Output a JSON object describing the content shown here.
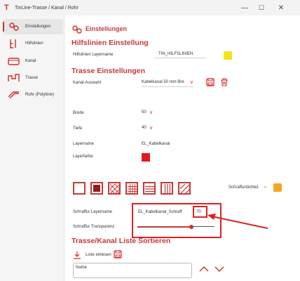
{
  "window": {
    "title": "TinLine-Trasse / Kanal / Rohr",
    "app_icon": "T",
    "min": "—",
    "max": "☐",
    "close": "✕"
  },
  "sidebar": {
    "items": [
      {
        "label": "Einstellungen",
        "icon": "settings-icon"
      },
      {
        "label": "Hilfslinien",
        "icon": "guideline-icon"
      },
      {
        "label": "Kanal",
        "icon": "channel-icon"
      },
      {
        "label": "Trasse",
        "icon": "route-icon"
      },
      {
        "label": "Rohr (Polylinie)",
        "icon": "pipe-icon"
      }
    ]
  },
  "page_title": "Einstellungen",
  "hilfslinien": {
    "title": "Hilfslinien Einstellung",
    "layer_label": "Hilfslinien Layername",
    "layer_value": "TIN_HILFSLINIEN",
    "layer_color": "#f4e21a"
  },
  "trasse": {
    "title": "Trasse Einstellungen",
    "kanal_label": "Kanal-Auswahl",
    "kanal_value": "Kabelkanal 50 mm Bre",
    "breite_label": "Breite",
    "breite_value": "50",
    "tiefe_label": "Tiefe",
    "tiefe_value": "40",
    "layername_label": "Layername",
    "layername_value": "EL_Kabelkanal",
    "layerfarbe_label": "Layerfarbe",
    "layer_color": "#e01b1b",
    "hatch_patterns": [
      "empty",
      "solid",
      "cross",
      "grid",
      "horizontal",
      "vertical",
      "diagonal"
    ],
    "dichte_label": "Schraffurdichte",
    "dichte_value": "1",
    "dichte_minus": "−",
    "dichte_color": "#f5a623",
    "schraffur_layer_label": "Schraffur Layername",
    "schraffur_layer_value": "EL_Kabelkanal_Schraff",
    "schraffur_number": "70",
    "transparenz_label": "Schraffur Transparenz",
    "transparenz_value": 0.7
  },
  "sortieren": {
    "title": "Trasse/Kanal Liste Sortieren",
    "einlesen_label": "Liste einlesen",
    "name_label": "Name"
  },
  "colors": {
    "accent": "#c43a3a",
    "highlight": "#e02020"
  }
}
